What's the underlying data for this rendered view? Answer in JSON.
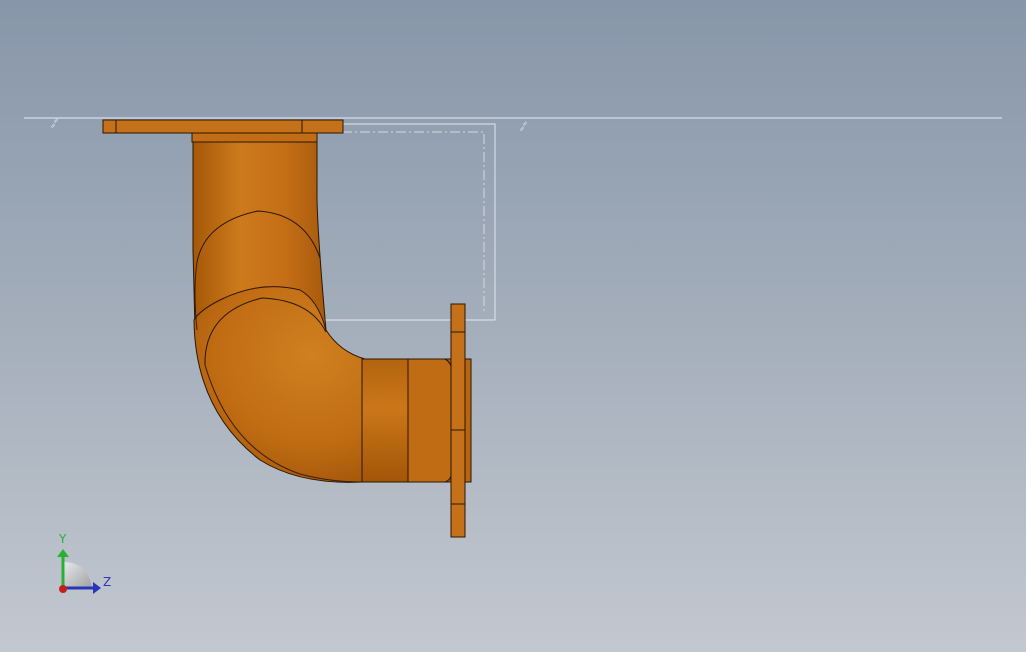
{
  "viewport": {
    "background_top": "#8796a9",
    "background_bottom": "#c3c8d0"
  },
  "model": {
    "part": "pipe-elbow-with-flanges",
    "body_color": "#c46e16",
    "edge_color": "#2a1606",
    "reference_line_color": "#e8ecf2",
    "sketch_line_color": "#dfe4ea"
  },
  "triad": {
    "y_label": "Y",
    "z_label": "Z",
    "y_color": "#27b033",
    "z_color": "#2a36b8",
    "x_color": "#c4201a"
  }
}
